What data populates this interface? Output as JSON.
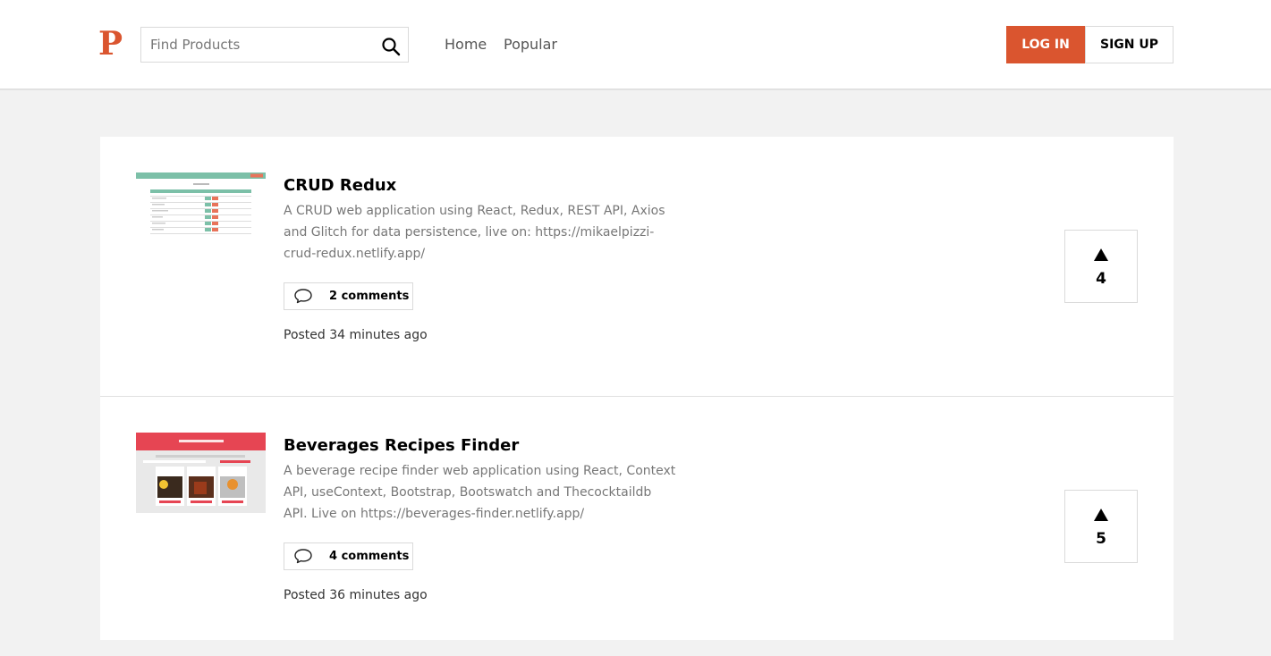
{
  "header": {
    "logo": "P",
    "search": {
      "placeholder": "Find Products",
      "value": ""
    },
    "nav": [
      "Home",
      "Popular"
    ],
    "login_label": "LOG IN",
    "signup_label": "SIGN UP"
  },
  "colors": {
    "brand": "#da552f",
    "background": "#f2f2f2"
  },
  "products": [
    {
      "title": "CRUD Redux",
      "description": "A CRUD web application using React, Redux, REST API, Axios and Glitch for data persistence, live on: https://mikaelpizzi-crud-redux.netlify.app/",
      "comments_label": "2 comments",
      "posted": "Posted 34 minutes ago",
      "votes": "4"
    },
    {
      "title": "Beverages Recipes Finder",
      "description": "A beverage recipe finder web application using React, Context API, useContext, Bootstrap, Bootswatch and Thecocktaildb API. Live on https://beverages-finder.netlify.app/",
      "comments_label": "4 comments",
      "posted": "Posted 36 minutes ago",
      "votes": "5"
    }
  ],
  "icons": {
    "search": "search-icon",
    "comment": "comment-icon",
    "upvote": "upvote-arrow-icon"
  }
}
